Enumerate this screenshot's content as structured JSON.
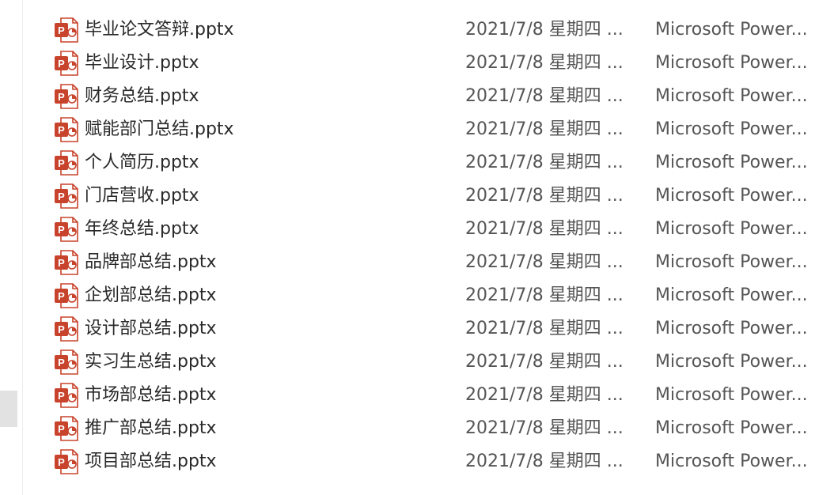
{
  "files": [
    {
      "name": "毕业论文答辩.pptx",
      "date": "2021/7/8 星期四 ...",
      "type": "Microsoft Power...",
      "icon": "pptx-file-icon"
    },
    {
      "name": "毕业设计.pptx",
      "date": "2021/7/8 星期四 ...",
      "type": "Microsoft Power...",
      "icon": "pptx-file-icon"
    },
    {
      "name": "财务总结.pptx",
      "date": "2021/7/8 星期四 ...",
      "type": "Microsoft Power...",
      "icon": "pptx-file-icon"
    },
    {
      "name": "赋能部门总结.pptx",
      "date": "2021/7/8 星期四 ...",
      "type": "Microsoft Power...",
      "icon": "pptx-file-icon"
    },
    {
      "name": "个人简历.pptx",
      "date": "2021/7/8 星期四 ...",
      "type": "Microsoft Power...",
      "icon": "pptx-file-icon"
    },
    {
      "name": "门店营收.pptx",
      "date": "2021/7/8 星期四 ...",
      "type": "Microsoft Power...",
      "icon": "pptx-file-icon"
    },
    {
      "name": "年终总结.pptx",
      "date": "2021/7/8 星期四 ...",
      "type": "Microsoft Power...",
      "icon": "pptx-file-icon"
    },
    {
      "name": "品牌部总结.pptx",
      "date": "2021/7/8 星期四 ...",
      "type": "Microsoft Power...",
      "icon": "pptx-file-icon"
    },
    {
      "name": "企划部总结.pptx",
      "date": "2021/7/8 星期四 ...",
      "type": "Microsoft Power...",
      "icon": "pptx-file-icon"
    },
    {
      "name": "设计部总结.pptx",
      "date": "2021/7/8 星期四 ...",
      "type": "Microsoft Power...",
      "icon": "pptx-file-icon"
    },
    {
      "name": "实习生总结.pptx",
      "date": "2021/7/8 星期四 ...",
      "type": "Microsoft Power...",
      "icon": "pptx-file-icon"
    },
    {
      "name": "市场部总结.pptx",
      "date": "2021/7/8 星期四 ...",
      "type": "Microsoft Power...",
      "icon": "pptx-file-icon"
    },
    {
      "name": "推广部总结.pptx",
      "date": "2021/7/8 星期四 ...",
      "type": "Microsoft Power...",
      "icon": "pptx-file-icon"
    },
    {
      "name": "项目部总结.pptx",
      "date": "2021/7/8 星期四 ...",
      "type": "Microsoft Power...",
      "icon": "pptx-file-icon"
    }
  ],
  "colors": {
    "pptx_brand": "#c8432b",
    "pptx_badge_light": "#f5e0dc",
    "text": "#2a2a2a",
    "muted_text": "#555555"
  }
}
